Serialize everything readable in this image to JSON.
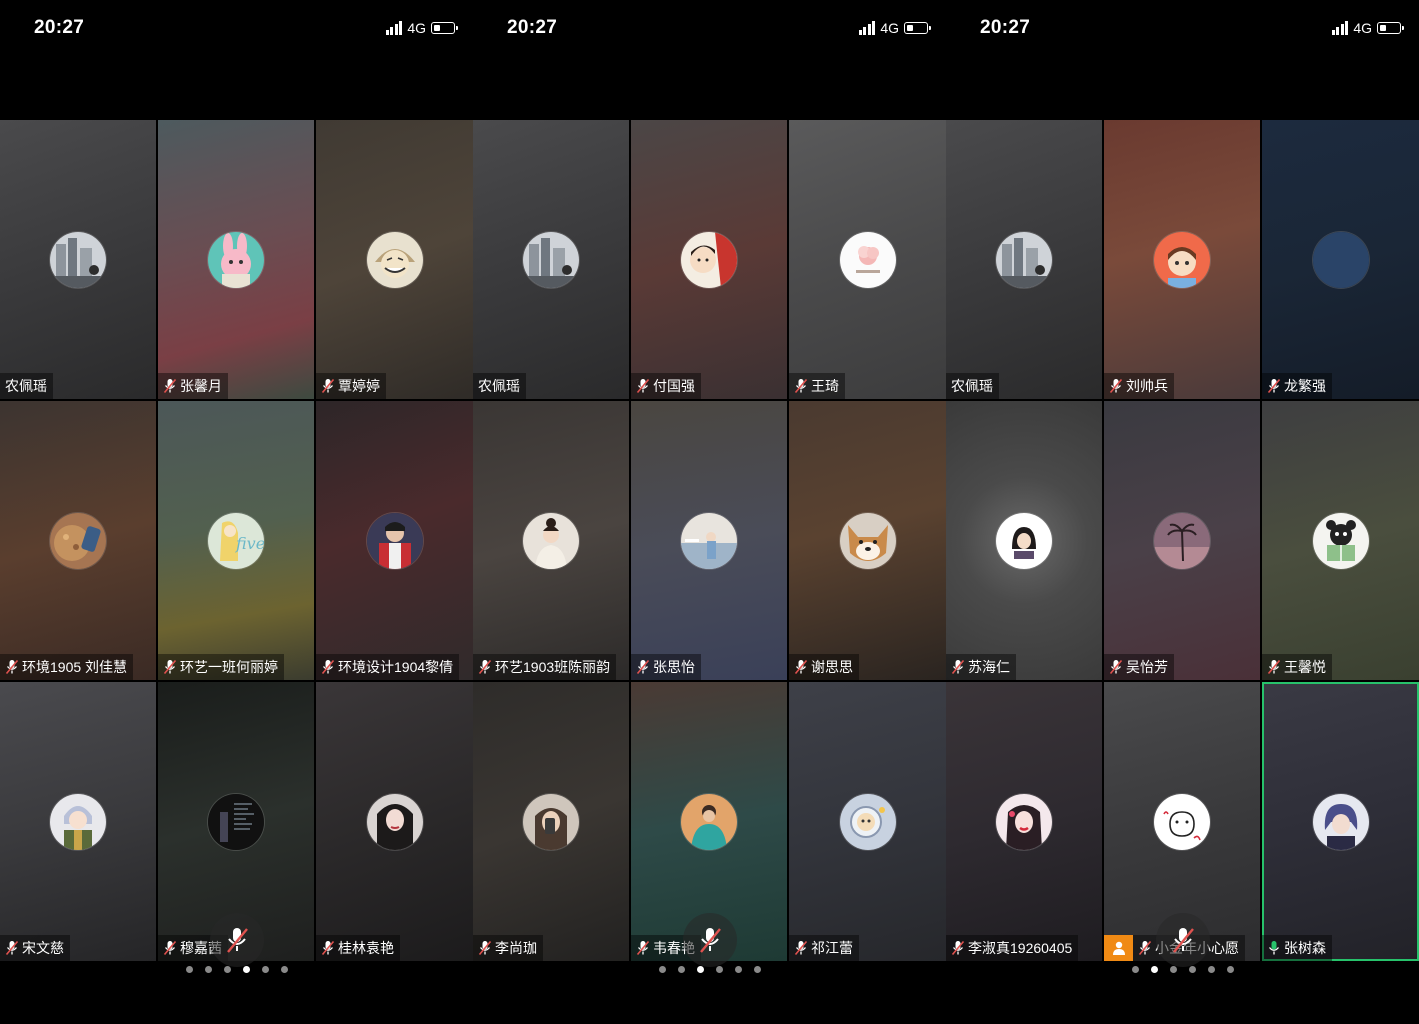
{
  "status_bar": {
    "time": "20:27",
    "network": "4G"
  },
  "colors": {
    "muted_mic": "#e0524f",
    "active_speaker_border": "#27c26b",
    "host_badge": "#f08a14",
    "dot_active": "#ffffff",
    "dot_inactive": "#8a8a8a"
  },
  "screens": [
    {
      "active_page_dot": 3,
      "page_count": 6,
      "tiles": [
        {
          "name": "农佩瑶",
          "muted": false,
          "avatar": "city-photo"
        },
        {
          "name": "张馨月",
          "muted": true,
          "avatar": "pink-rabbit"
        },
        {
          "name": "覃婷婷",
          "muted": true,
          "avatar": "smiling-girl-sketch"
        },
        {
          "name": "环境1905 刘佳慧",
          "muted": true,
          "avatar": "brown-food"
        },
        {
          "name": "环艺一班何丽婷",
          "muted": true,
          "avatar": "five-illustration"
        },
        {
          "name": "环境设计1904黎倩",
          "muted": true,
          "avatar": "red-jacket-person"
        },
        {
          "name": "宋文慈",
          "muted": true,
          "avatar": "anime-girl"
        },
        {
          "name": "穆嘉茜",
          "muted": true,
          "avatar": "dark-text-poster"
        },
        {
          "name": "桂林袁艳",
          "muted": true,
          "avatar": "long-hair-girl"
        }
      ]
    },
    {
      "active_page_dot": 2,
      "page_count": 6,
      "tiles": [
        {
          "name": "农佩瑶",
          "muted": false,
          "avatar": "city-photo"
        },
        {
          "name": "付国强",
          "muted": true,
          "avatar": "cartoon-boy"
        },
        {
          "name": "王琦",
          "muted": true,
          "avatar": "pink-flower-logo"
        },
        {
          "name": "环艺1903班陈丽韵",
          "muted": true,
          "avatar": "bun-hair-girl"
        },
        {
          "name": "张思怡",
          "muted": true,
          "avatar": "seaside-girl"
        },
        {
          "name": "谢思思",
          "muted": true,
          "avatar": "shiba-dog"
        },
        {
          "name": "李尚珈",
          "muted": true,
          "avatar": "mirror-selfie"
        },
        {
          "name": "韦春艳",
          "muted": true,
          "avatar": "teal-shirt-person"
        },
        {
          "name": "祁江蕾",
          "muted": true,
          "avatar": "cartoon-astronaut"
        }
      ]
    },
    {
      "active_page_dot": 1,
      "page_count": 6,
      "tiles": [
        {
          "name": "农佩瑶",
          "muted": false,
          "avatar": "city-photo"
        },
        {
          "name": "刘帅兵",
          "muted": true,
          "avatar": "cartoon-kid"
        },
        {
          "name": "龙繁强",
          "muted": true,
          "avatar": "plain-blue"
        },
        {
          "name": "苏海仁",
          "muted": true,
          "avatar": "dark-hair-cartoon"
        },
        {
          "name": "吴怡芳",
          "muted": true,
          "avatar": "palm-tree"
        },
        {
          "name": "王馨悦",
          "muted": true,
          "avatar": "black-cat-reading"
        },
        {
          "name": "李淑真19260405",
          "muted": true,
          "avatar": "red-lip-girl"
        },
        {
          "name": "小金年小心愿",
          "muted": true,
          "host": true,
          "avatar": "doodle-bear"
        },
        {
          "name": "张树森",
          "muted": false,
          "speaking": true,
          "avatar": "blue-hair-anime"
        }
      ]
    }
  ]
}
